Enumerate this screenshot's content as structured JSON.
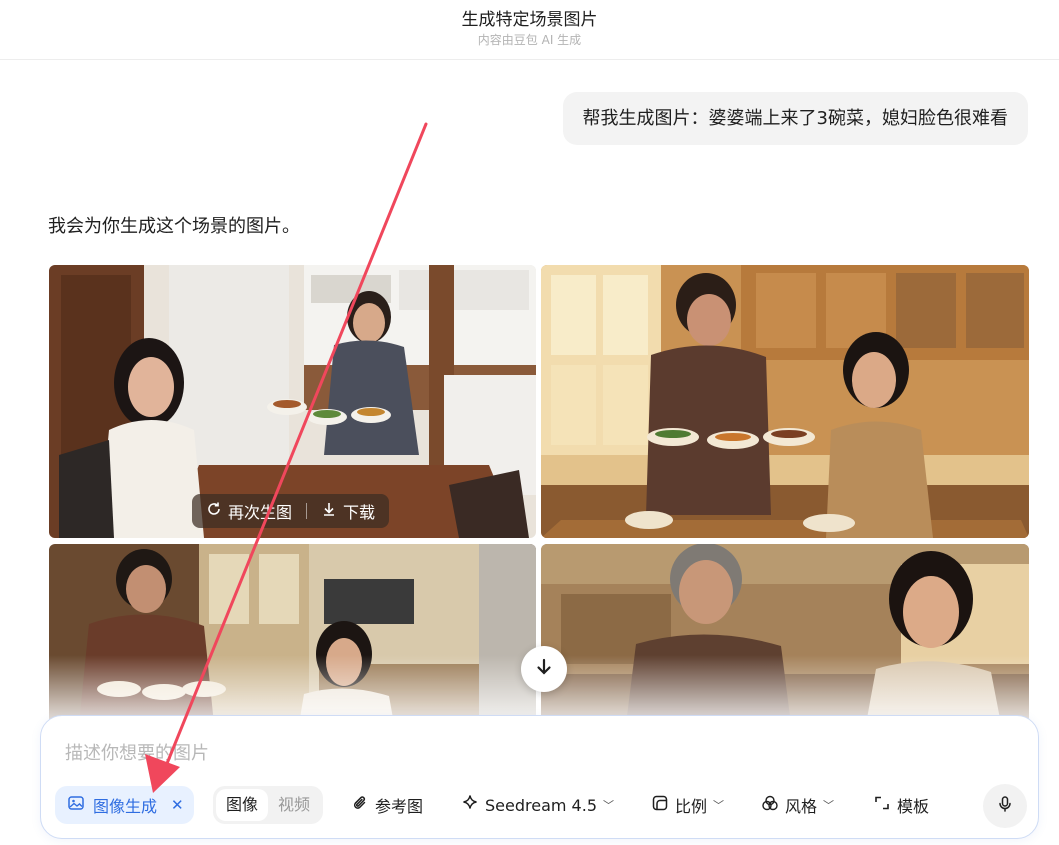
{
  "header": {
    "title": "生成特定场景图片",
    "subtitle": "内容由豆包 AI 生成"
  },
  "chat": {
    "user_message": "帮我生成图片：婆婆端上来了3碗菜，媳妇脸色很难看",
    "assistant_reply": "我会为你生成这个场景的图片。"
  },
  "image_actions": {
    "regenerate_label": "再次生图",
    "download_label": "下载"
  },
  "composer": {
    "placeholder": "描述你想要的图片",
    "mode_chip_label": "图像生成",
    "segment_image": "图像",
    "segment_video": "视频",
    "reference_label": "参考图",
    "model_label": "Seedream 4.5",
    "ratio_label": "比例",
    "style_label": "风格",
    "template_label": "模板"
  },
  "colors": {
    "accent": "#2f6de1",
    "annotation_arrow": "#f0475c"
  },
  "icons": [
    "refresh-icon",
    "download-icon",
    "arrow-down-icon",
    "image-icon",
    "close-icon",
    "paperclip-icon",
    "sparkle-icon",
    "ratio-icon",
    "palette-icon",
    "expand-icon",
    "microphone-icon"
  ]
}
